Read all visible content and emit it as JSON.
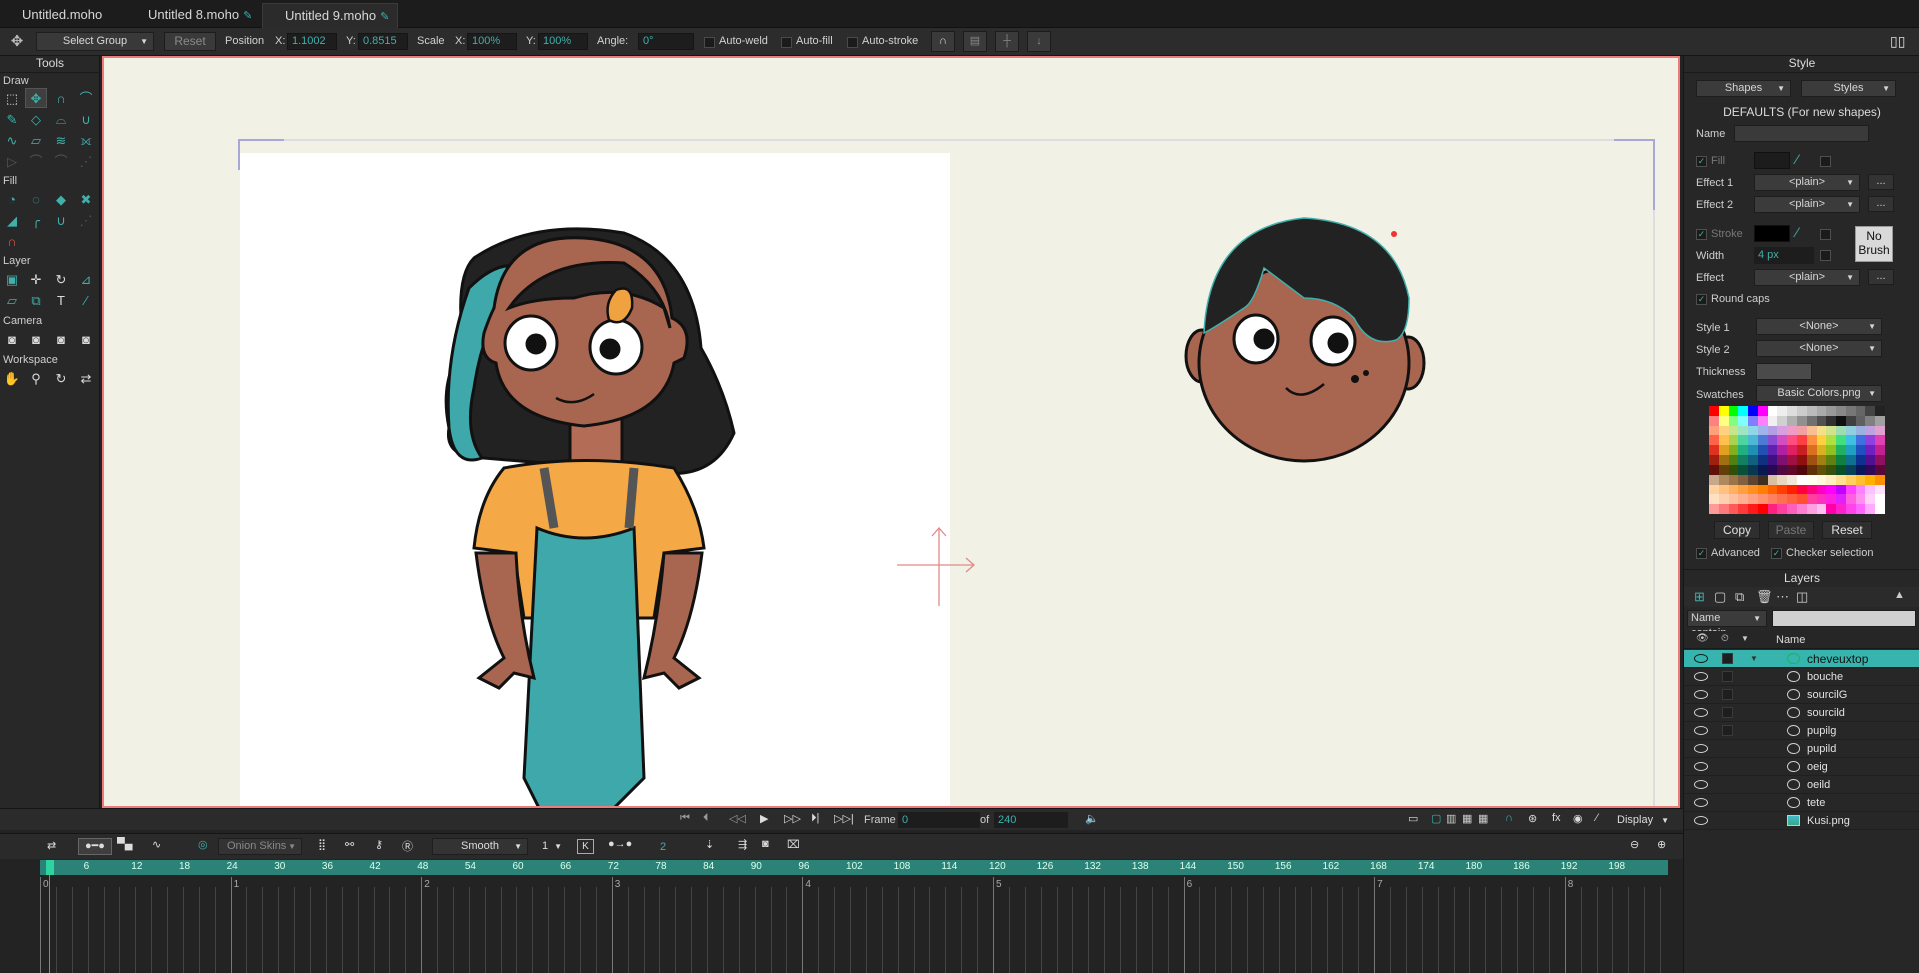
{
  "tabs": [
    {
      "label": "Untitled.moho",
      "edited": false
    },
    {
      "label": "Untitled 8.moho",
      "edited": true
    },
    {
      "label": "Untitled 9.moho",
      "edited": true
    }
  ],
  "toolbar": {
    "select_group": "Select Group",
    "reset": "Reset",
    "position": "Position",
    "x_label": "X:",
    "x_value": "1.1002",
    "y_label": "Y:",
    "y_value": "0.8515",
    "scale": "Scale",
    "sx_label": "X:",
    "sx_value": "100%",
    "sy_label": "Y:",
    "sy_value": "100%",
    "angle_label": "Angle:",
    "angle_value": "0°",
    "auto_weld": "Auto-weld",
    "auto_fill": "Auto-fill",
    "auto_stroke": "Auto-stroke"
  },
  "tools": {
    "title": "Tools",
    "sections": [
      "Draw",
      "Fill",
      "Layer",
      "Camera",
      "Workspace"
    ]
  },
  "style": {
    "title": "Style",
    "shapes_dd": "Shapes",
    "styles_dd": "Styles",
    "defaults": "DEFAULTS (For new shapes)",
    "name": "Name",
    "fill": "Fill",
    "effect1": "Effect 1",
    "effect1_val": "<plain>",
    "effect2": "Effect 2",
    "effect2_val": "<plain>",
    "stroke": "Stroke",
    "no_brush": "No Brush",
    "width": "Width",
    "width_val": "4 px",
    "effect": "Effect",
    "effect_val": "<plain>",
    "round_caps": "Round caps",
    "style1": "Style 1",
    "style1_val": "<None>",
    "style2": "Style 2",
    "style2_val": "<None>",
    "thickness": "Thickness",
    "swatches": "Swatches",
    "swatches_val": "Basic Colors.png",
    "copy": "Copy",
    "paste": "Paste",
    "reset": "Reset",
    "advanced": "Advanced",
    "checker": "Checker selection",
    "more": "..."
  },
  "layers": {
    "title": "Layers",
    "filter": "Name contain...",
    "col_name": "Name",
    "items": [
      "cheveuxtop",
      "bouche",
      "sourcilG",
      "sourcild",
      "pupilg",
      "pupild",
      "oeig",
      "oeild",
      "tete",
      "Kusi.png"
    ],
    "selected": "cheveuxtop"
  },
  "playbar": {
    "frame_label": "Frame",
    "frame": "0",
    "of_label": "of",
    "total": "240",
    "display": "Display"
  },
  "timeline": {
    "onion": "Onion Skins",
    "interp": "Smooth",
    "n1": "1",
    "n2": "2",
    "key": "K",
    "ruler": [
      "6",
      "12",
      "18",
      "24",
      "30",
      "36",
      "42",
      "48",
      "54",
      "60",
      "66",
      "72",
      "78",
      "84",
      "90",
      "96",
      "102",
      "108",
      "114",
      "120",
      "126",
      "132",
      "138",
      "144",
      "150",
      "156",
      "162",
      "168",
      "174",
      "180",
      "186",
      "192",
      "198"
    ],
    "seconds": [
      "0",
      "1",
      "2",
      "3",
      "4",
      "5",
      "6",
      "7",
      "8"
    ]
  },
  "colors": {
    "accent": "#3fb0ac",
    "canvas_bg": "#f1f1e5",
    "selection_border": "#ec7b7b"
  }
}
